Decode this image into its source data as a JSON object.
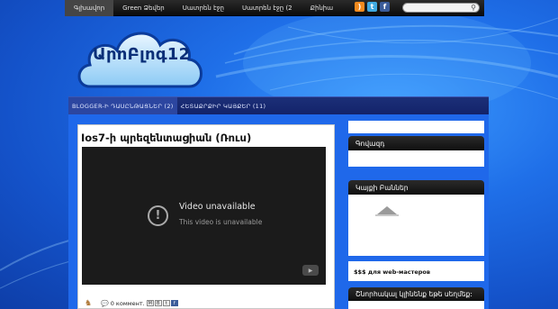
{
  "topnav": {
    "items": [
      {
        "label": "Գլխավոր",
        "active": true
      },
      {
        "label": "Green Ձեվեր",
        "active": false
      },
      {
        "label": "Սատրեն էջը",
        "active": false
      },
      {
        "label": "Սատրեն էջը (2",
        "active": false
      },
      {
        "label": "Քինիա",
        "active": false
      }
    ],
    "social_icons": [
      "rss-icon",
      "twitter-icon",
      "facebook-icon"
    ],
    "search_placeholder": ""
  },
  "logo": {
    "text": "ԱրոԲլոգ12"
  },
  "subnav": {
    "items": [
      {
        "label": "BLOGGER-Ի ԴԱՍԸՆԹԱՑՆԵՐ (2)",
        "active": true
      },
      {
        "label": "ՀԵՏԱՔՐՔԻՐ ԿԱՅՔԵՐ (11)",
        "active": false
      }
    ]
  },
  "post": {
    "title": "Ios7-ի պրեզենտացիան (Ռուս)",
    "video": {
      "title": "Video unavailable",
      "subtitle": "This video is unavailable"
    },
    "footer": {
      "comments": "0 коммент."
    }
  },
  "sidebar": {
    "boxes": [
      {
        "heading": "Գովազդ"
      },
      {
        "heading": "Կայքի Բաններ"
      },
      {
        "heading": "Շնորհակալ կլինենք եթե սեղմեք:"
      }
    ],
    "link_text": "$$$ для web-мастеров"
  },
  "colors": {
    "accent": "#1f68ea",
    "nav_dark": "#111111",
    "subnav": "#1c2f78"
  }
}
